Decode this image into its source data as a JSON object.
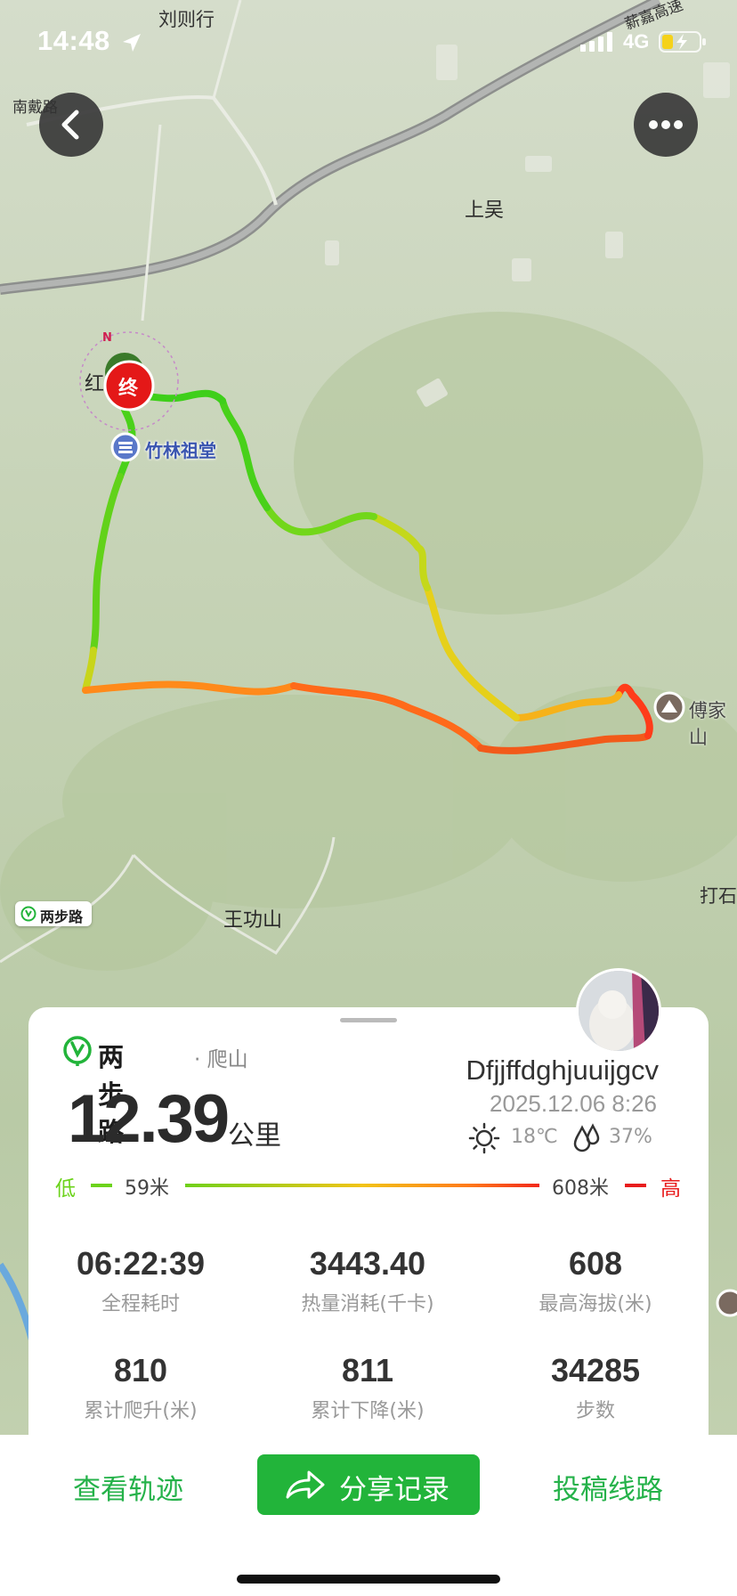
{
  "status_bar": {
    "time": "14:48",
    "network": "4G"
  },
  "map": {
    "labels": [
      "刘则行",
      "薪嘉高速",
      "南戴路",
      "上吴",
      "红",
      "竹林祖堂",
      "傅家山",
      "打石",
      "王功山"
    ],
    "end_marker": "终",
    "compass": "N",
    "brand_chip": "两步路"
  },
  "record": {
    "app_name": "两步路",
    "activity": "· 爬山",
    "distance": "12.39",
    "distance_unit": "公里",
    "username": "Dfjjffdghjuuijgcv",
    "datetime": "2025.12.06 8:26",
    "temperature": "18℃",
    "humidity": "37%"
  },
  "elevation_legend": {
    "low_label": "低",
    "low_value": "59米",
    "high_value": "608米",
    "high_label": "高"
  },
  "stats": [
    {
      "value": "06:22:39",
      "label": "全程耗时"
    },
    {
      "value": "3443.40",
      "label": "热量消耗(千卡)"
    },
    {
      "value": "608",
      "label": "最高海拔(米)"
    },
    {
      "value": "810",
      "label": "累计爬升(米)"
    },
    {
      "value": "811",
      "label": "累计下降(米)"
    },
    {
      "value": "34285",
      "label": "步数"
    }
  ],
  "actions": {
    "view_track": "查看轨迹",
    "share": "分享记录",
    "submit_route": "投稿线路"
  },
  "colors": {
    "accent_green": "#22b43a",
    "elev_low": "#6cd31b",
    "elev_high": "#e81c1c"
  }
}
